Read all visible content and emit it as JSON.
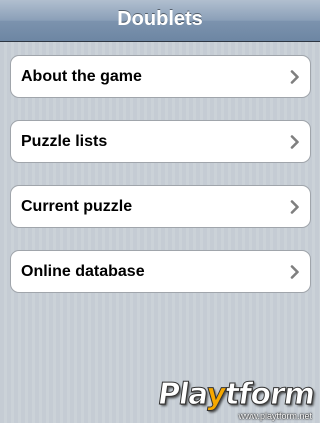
{
  "nav": {
    "title": "Doublets"
  },
  "menu": {
    "items": [
      {
        "label": "About the game",
        "icon": "chevron-right-icon"
      },
      {
        "label": "Puzzle lists",
        "icon": "chevron-right-icon"
      },
      {
        "label": "Current puzzle",
        "icon": "chevron-right-icon"
      },
      {
        "label": "Online database",
        "icon": "chevron-right-icon"
      }
    ]
  },
  "watermark": {
    "brand_prefix": "Pla",
    "brand_accent": "y",
    "brand_suffix": "tform",
    "url": "www.playtform.net"
  },
  "colors": {
    "nav_bar": "#6d86a3",
    "background": "#c5ccd4",
    "chevron": "#7f7f7f",
    "watermark_accent": "#f6a800"
  }
}
